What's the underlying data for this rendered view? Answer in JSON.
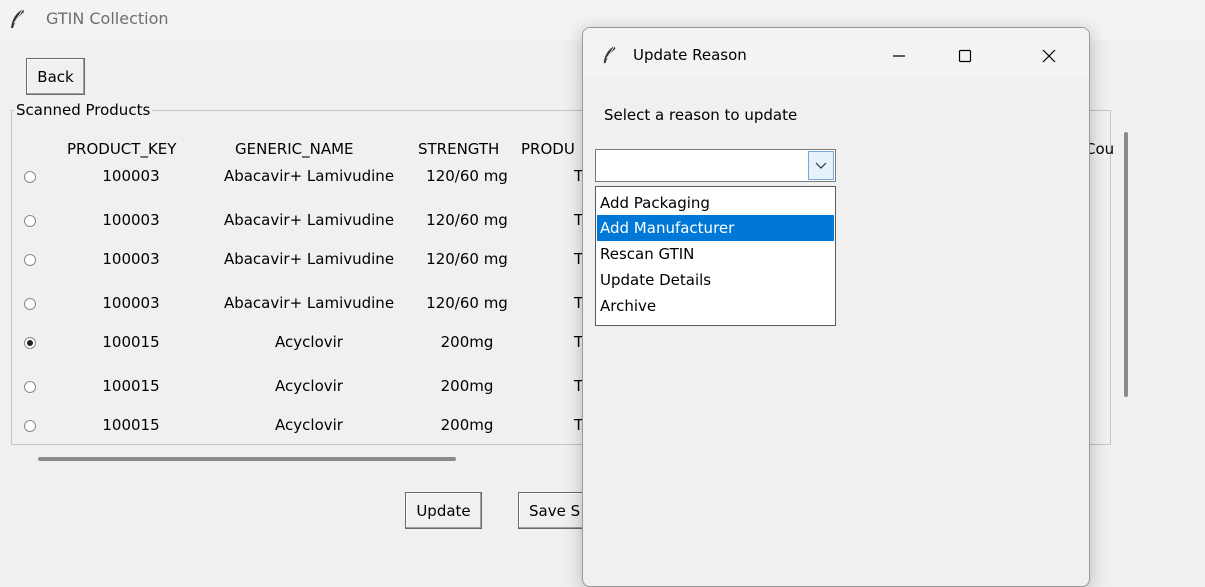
{
  "main_window": {
    "title": "GTIN Collection",
    "back_label": "Back",
    "frame_label": "Scanned Products",
    "update_label": "Update",
    "save_label": "Save S"
  },
  "table": {
    "columns": [
      "PRODUCT_KEY",
      "GENERIC_NAME",
      "STRENGTH",
      "PRODU",
      "Cou"
    ],
    "rows": [
      {
        "selected": false,
        "product_key": "100003",
        "generic_name": "Abacavir+ Lamivudine",
        "strength": "120/60 mg",
        "product": "T"
      },
      {
        "selected": false,
        "product_key": "100003",
        "generic_name": "Abacavir+ Lamivudine",
        "strength": "120/60 mg",
        "product": "T"
      },
      {
        "selected": false,
        "product_key": "100003",
        "generic_name": "Abacavir+ Lamivudine",
        "strength": "120/60 mg",
        "product": "T"
      },
      {
        "selected": false,
        "product_key": "100003",
        "generic_name": "Abacavir+ Lamivudine",
        "strength": "120/60 mg",
        "product": "T"
      },
      {
        "selected": true,
        "product_key": "100015",
        "generic_name": "Acyclovir",
        "strength": "200mg",
        "product": "T"
      },
      {
        "selected": false,
        "product_key": "100015",
        "generic_name": "Acyclovir",
        "strength": "200mg",
        "product": "T"
      },
      {
        "selected": false,
        "product_key": "100015",
        "generic_name": "Acyclovir",
        "strength": "200mg",
        "product": "T"
      }
    ]
  },
  "dialog": {
    "title": "Update Reason",
    "prompt": "Select a reason to update",
    "combo_value": "",
    "options": [
      "Add Packaging",
      "Add Manufacturer",
      "Rescan GTIN",
      "Update Details",
      "Archive"
    ],
    "highlighted_option": "Add Manufacturer",
    "highlight_color": "#0078d7"
  },
  "icons": [
    "feather-icon",
    "minimize-icon",
    "maximize-icon",
    "close-icon",
    "chevron-down-icon"
  ]
}
